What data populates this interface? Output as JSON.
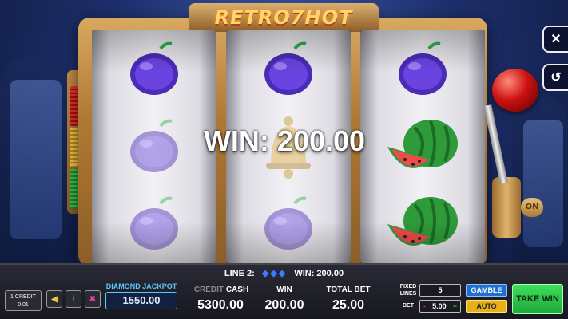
{
  "game": {
    "title": "RETRO7HOT"
  },
  "win_banner": "WIN: 200.00",
  "lever": {
    "on_label": "ON"
  },
  "reels": [
    [
      "plum",
      "plum",
      "plum"
    ],
    [
      "plum",
      "bell",
      "plum"
    ],
    [
      "plum",
      "watermelon",
      "watermelon"
    ]
  ],
  "line_info": {
    "line_label": "LINE 2:",
    "win_label": "WIN: 200.00"
  },
  "controls": {
    "credit_line1": "1 CREDIT",
    "credit_line2": "0.01",
    "jackpot_label": "DIAMOND JACKPOT",
    "jackpot_value": "1550.00",
    "credit_label": "CREDIT",
    "cash_label": "CASH",
    "cash_value": "5300.00",
    "win_label": "WIN",
    "win_value": "200.00",
    "total_bet_label": "TOTAL BET",
    "total_bet_value": "25.00",
    "fixed_lines_label": "FIXED LINES",
    "fixed_lines_value": "5",
    "bet_label": "BET",
    "bet_minus": "-",
    "bet_value": "5.00",
    "bet_plus": "+",
    "gamble_label": "GAMBLE",
    "auto_label": "AUTO",
    "take_win_label": "TAKE WIN"
  },
  "colors": {
    "accent_blue": "#1f6fd0",
    "take_win_green": "#3ee05a",
    "auto_yellow": "#e5b116",
    "jackpot_blue": "#5fc6ff"
  }
}
